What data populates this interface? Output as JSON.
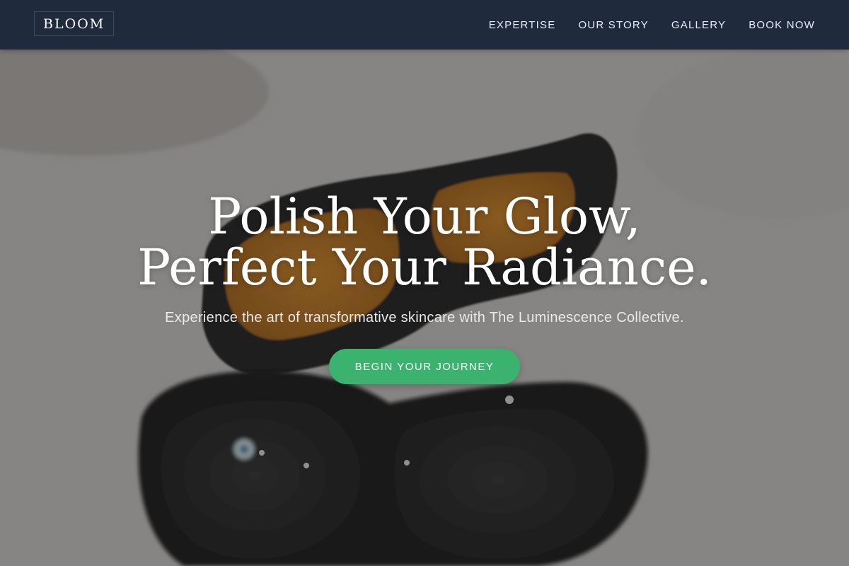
{
  "header": {
    "logo": "BLOOM",
    "nav": [
      {
        "label": "EXPERTISE"
      },
      {
        "label": "OUR STORY"
      },
      {
        "label": "GALLERY"
      },
      {
        "label": "BOOK NOW"
      }
    ]
  },
  "hero": {
    "headline_line1": "Polish Your Glow,",
    "headline_line2": "Perfect Your Radiance.",
    "subtitle": "Experience the art of transformative skincare with The Luminescence Collective.",
    "cta_label": "BEGIN YOUR JOURNEY",
    "image_subject": "protective-eyewear-photo"
  },
  "colors": {
    "header_bg": "#1f2a3c",
    "cta_bg": "#3bb36e",
    "text_light": "#ffffff"
  }
}
